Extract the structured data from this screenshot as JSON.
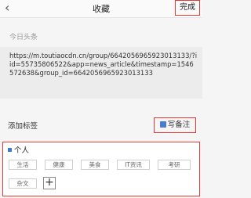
{
  "header": {
    "back_glyph": "‹",
    "title": "收藏",
    "done_label": "完成"
  },
  "source_name": "今日头条",
  "article_url": "https://m.toutiaocdn.cn/group/6642056965923013133/?iid=55735806522&app=news_article&timestamp=1546572638&group_id=6642056965923013133",
  "add_tag_label": "添加标签",
  "note_button_label": "写备注",
  "personal": {
    "title": "个人",
    "tags_row1": [
      "生活",
      "健康",
      "美食",
      "IT资讯",
      "考研"
    ],
    "tags_row2": [
      "杂文"
    ],
    "add_glyph": "+"
  },
  "colors": {
    "highlight": "#e53935",
    "accent": "#3a7bd5"
  }
}
